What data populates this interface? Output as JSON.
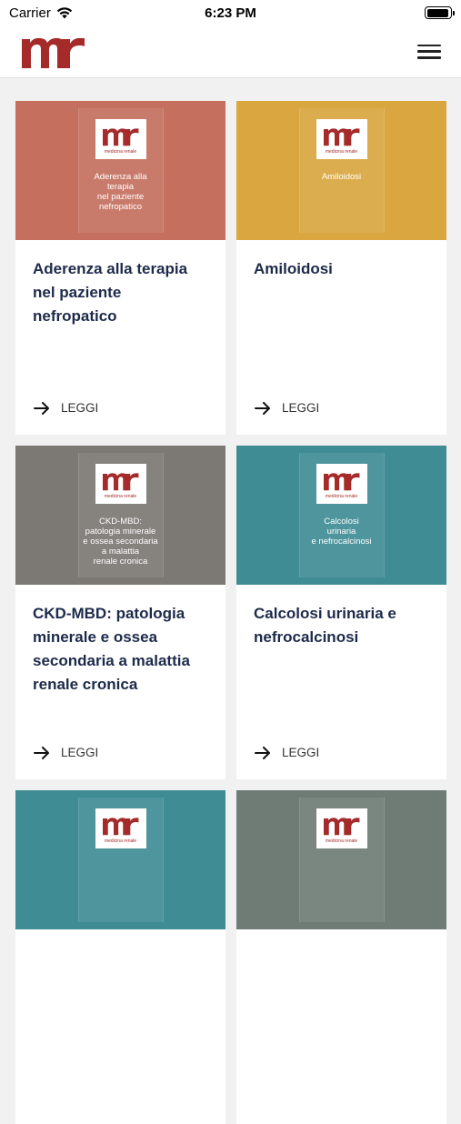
{
  "status_bar": {
    "carrier": "Carrier",
    "time": "6:23 PM",
    "battery_level": 0.95
  },
  "header": {
    "logo_icon": "medicina-renale-logo",
    "menu_icon": "hamburger-menu-icon"
  },
  "brand_colors": {
    "logo_red": "#a52a2a",
    "title_navy": "#1d2a4a"
  },
  "cards": [
    {
      "cover_title": "Aderenza alla\nterapia\nnel paziente\nnefropatico",
      "title": "Aderenza alla terapia nel paziente nefropatico",
      "action": "LEGGI",
      "color": "#c5705f"
    },
    {
      "cover_title": "Amiloidosi",
      "title": "Amiloidosi",
      "action": "LEGGI",
      "color": "#d9a63f"
    },
    {
      "cover_title": "CKD-MBD:\npatologia minerale\ne ossea secondaria\na malattia\nrenale cronica",
      "title": "CKD-MBD: patologia minerale e ossea secondaria a malattia renale cronica",
      "action": "LEGGI",
      "color": "#7c7873"
    },
    {
      "cover_title": "Calcolosi\nurinaria\ne nefrocalcinosi",
      "title": "Calcolosi urinaria e nefrocalcinosi",
      "action": "LEGGI",
      "color": "#3f8c95"
    },
    {
      "cover_title": "",
      "title": "",
      "action": "",
      "color": "#3f8c95"
    },
    {
      "cover_title": "",
      "title": "",
      "action": "",
      "color": "#6f7c76"
    }
  ],
  "cover_logo_text": "medicina renale"
}
